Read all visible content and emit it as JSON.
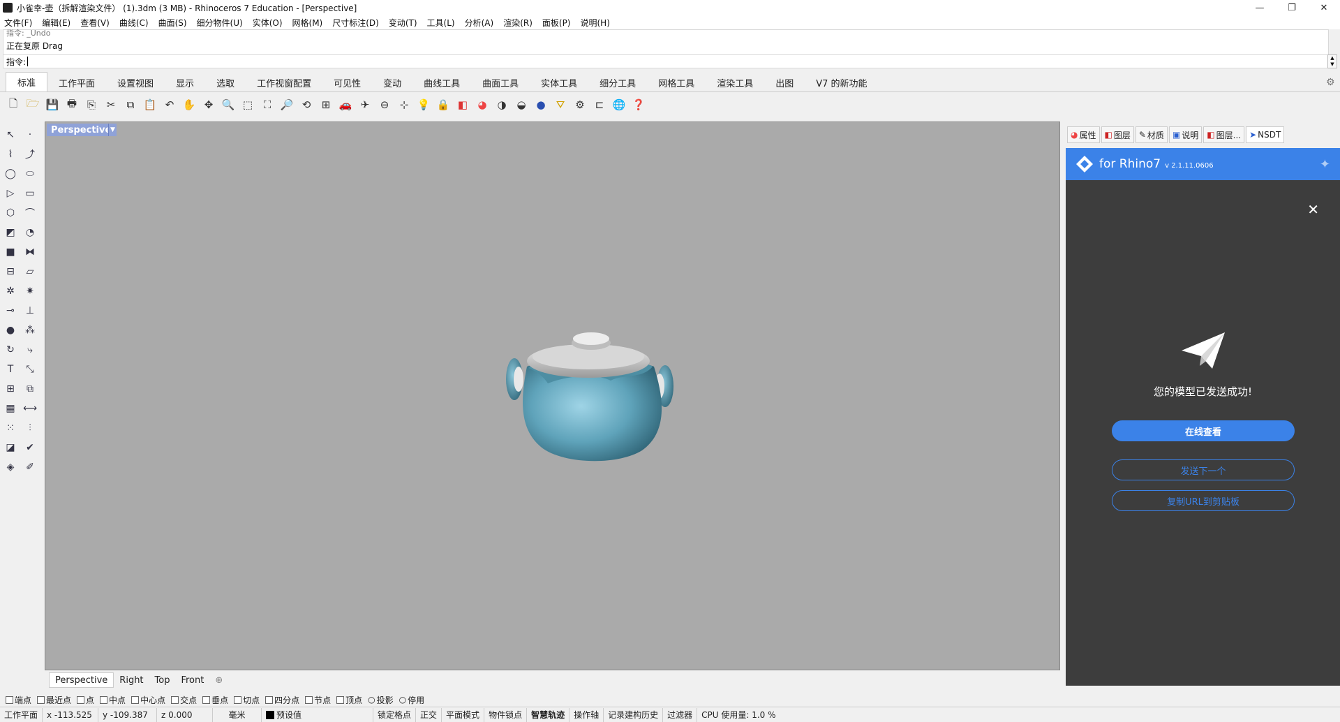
{
  "window": {
    "title": "小雀幸-壶（拆解渲染文件） (1).3dm (3 MB) - Rhinoceros 7 Education - [Perspective]",
    "controls": [
      "—",
      "❐",
      "✕"
    ]
  },
  "menu": [
    "文件(F)",
    "编辑(E)",
    "查看(V)",
    "曲线(C)",
    "曲面(S)",
    "细分物件(U)",
    "实体(O)",
    "网格(M)",
    "尺寸标注(D)",
    "变动(T)",
    "工具(L)",
    "分析(A)",
    "渲染(R)",
    "面板(P)",
    "说明(H)"
  ],
  "command": {
    "history_line1": "指令: _Undo",
    "history_line2": "正在复原 Drag",
    "prompt": "指令:"
  },
  "toolbar_tabs": [
    "标准",
    "工作平面",
    "设置视图",
    "显示",
    "选取",
    "工作视窗配置",
    "可见性",
    "变动",
    "曲线工具",
    "曲面工具",
    "实体工具",
    "细分工具",
    "网格工具",
    "渲染工具",
    "出图",
    "V7 的新功能"
  ],
  "viewport": {
    "name": "Perspective",
    "background": "#aaaaaa",
    "model_color": "#6fb3c9",
    "tabs": [
      "Perspective",
      "Right",
      "Top",
      "Front",
      "⊕"
    ]
  },
  "panel": {
    "tabs": [
      {
        "icon": "◕",
        "label": "属性"
      },
      {
        "icon": "◧",
        "label": "图层"
      },
      {
        "icon": "✎",
        "label": "材质"
      },
      {
        "icon": "▣",
        "label": "说明"
      },
      {
        "icon": "◧",
        "label": "图层..."
      },
      {
        "icon": "➤",
        "label": "NSDT"
      }
    ],
    "brand": "for Rhino7",
    "version": "v 2.1.11.0606",
    "success_message": "您的模型已发送成功!",
    "btn_view_online": "在线查看",
    "btn_send_next": "发送下一个",
    "btn_copy_url": "复制URL到剪贴板",
    "accent": "#3b82e8"
  },
  "osnap": [
    "端点",
    "最近点",
    "点",
    "中点",
    "中心点",
    "交点",
    "垂点",
    "切点",
    "四分点",
    "节点",
    "顶点",
    "投影",
    "停用"
  ],
  "status": {
    "cplane": "工作平面",
    "x": "x -113.525",
    "y": "y -109.387",
    "z": "z 0.000",
    "units": "毫米",
    "layer": "预设值",
    "grid_snap": "锁定格点",
    "ortho": "正交",
    "planar": "平面模式",
    "osnap": "物件锁点",
    "smarttrack": "智慧轨迹",
    "gumball": "操作轴",
    "history": "记录建构历史",
    "filter": "过滤器",
    "cpu": "CPU 使用量: 1.0 %"
  }
}
